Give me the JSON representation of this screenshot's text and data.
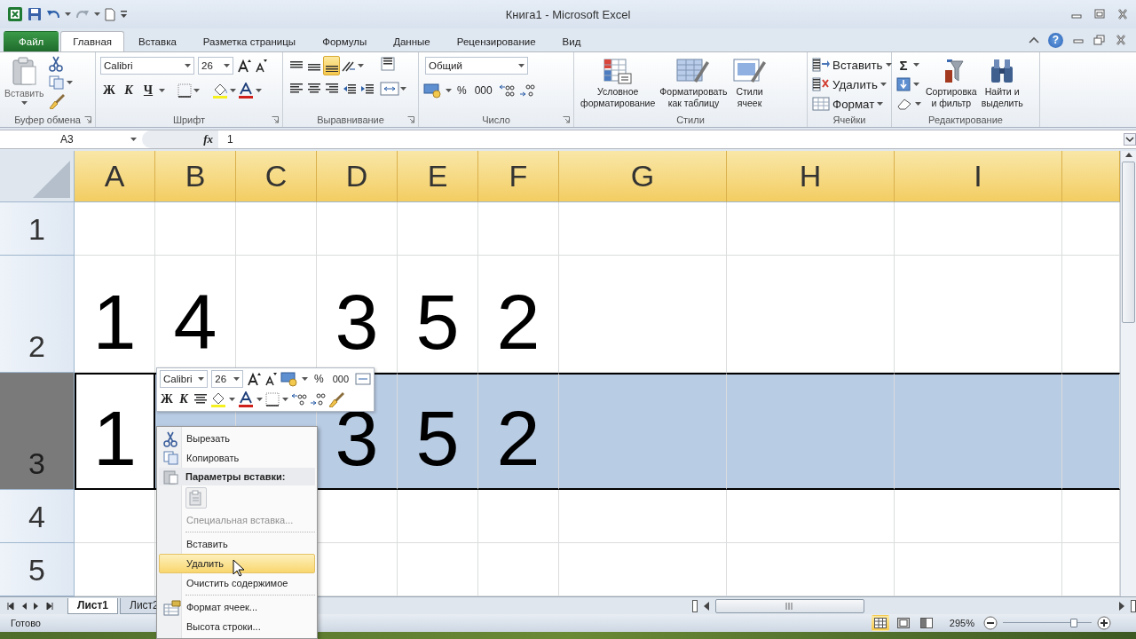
{
  "window": {
    "title": "Книга1 - Microsoft Excel",
    "help": "?"
  },
  "ribbon_tabs": [
    {
      "label": "Файл",
      "kind": "file",
      "selected": false
    },
    {
      "label": "Главная",
      "kind": "tab",
      "selected": true
    },
    {
      "label": "Вставка",
      "kind": "tab",
      "selected": false
    },
    {
      "label": "Разметка страницы",
      "kind": "tab",
      "selected": false
    },
    {
      "label": "Формулы",
      "kind": "tab",
      "selected": false
    },
    {
      "label": "Данные",
      "kind": "tab",
      "selected": false
    },
    {
      "label": "Рецензирование",
      "kind": "tab",
      "selected": false
    },
    {
      "label": "Вид",
      "kind": "tab",
      "selected": false
    }
  ],
  "ribbon_groups": [
    {
      "kind": "clipboard",
      "label": "Буфер обмена",
      "paste": "Вставить"
    },
    {
      "kind": "font",
      "label": "Шрифт",
      "font": "Calibri",
      "size": "26",
      "bold": "Ж",
      "italic": "К",
      "underline": "Ч"
    },
    {
      "kind": "alignment",
      "label": "Выравнивание",
      "align_bottom_on": true
    },
    {
      "kind": "number",
      "label": "Число",
      "format": "Общий",
      "percent": "%",
      "thousands": "000"
    },
    {
      "kind": "styles",
      "label": "Стили",
      "buttons": [
        {
          "lines": [
            "Условное",
            "форматирование"
          ]
        },
        {
          "lines": [
            "Форматировать",
            "как таблицу"
          ]
        },
        {
          "lines": [
            "Стили",
            "ячеек"
          ]
        }
      ]
    },
    {
      "kind": "cells",
      "label": "Ячейки",
      "buttons": [
        "Вставить",
        "Удалить",
        "Формат"
      ]
    },
    {
      "kind": "editing",
      "label": "Редактирование",
      "sum": "Σ",
      "buttons": [
        {
          "lines": [
            "Сортировка",
            "и фильтр"
          ]
        },
        {
          "lines": [
            "Найти и",
            "выделить"
          ]
        }
      ]
    }
  ],
  "formula_bar": {
    "name_box": "A3",
    "fx": "fx",
    "formula": "1"
  },
  "sheet": {
    "columns": [
      {
        "label": "A",
        "highlighted": true
      },
      {
        "label": "B",
        "highlighted": true
      },
      {
        "label": "C",
        "highlighted": true
      },
      {
        "label": "D",
        "highlighted": true
      },
      {
        "label": "E",
        "highlighted": true
      },
      {
        "label": "F",
        "highlighted": true
      },
      {
        "label": "G",
        "highlighted": true
      },
      {
        "label": "H",
        "highlighted": true
      },
      {
        "label": "I",
        "highlighted": true
      }
    ],
    "rows": [
      {
        "header": "1",
        "selected": false
      },
      {
        "header": "2",
        "selected": false,
        "cells": [
          {
            "value": "1",
            "active": false
          },
          {
            "value": "4",
            "active": false
          },
          null,
          {
            "value": "3",
            "active": false
          },
          {
            "value": "5",
            "active": false
          },
          {
            "value": "2",
            "active": false
          }
        ]
      },
      {
        "header": "3",
        "selected": true,
        "cells": [
          {
            "value": "1",
            "active": true
          },
          null,
          null,
          {
            "value": "3",
            "active": false
          },
          {
            "value": "5",
            "active": false
          },
          {
            "value": "2",
            "active": false
          }
        ]
      },
      {
        "header": "4",
        "selected": false
      },
      {
        "header": "5",
        "selected": false
      }
    ]
  },
  "mini_toolbar": {
    "font": "Calibri",
    "size": "26",
    "bold": "Ж",
    "italic": "К",
    "percent": "%",
    "thousands": "000"
  },
  "context_menu": [
    {
      "kind": "cut",
      "label": "Вырезать",
      "disabled": false,
      "selected": false
    },
    {
      "kind": "copy",
      "label": "Копировать",
      "disabled": false,
      "selected": false
    },
    {
      "kind": "paste-header",
      "label": "Параметры вставки:"
    },
    {
      "kind": "paste-option"
    },
    {
      "kind": "plain",
      "label": "Специальная вставка...",
      "disabled": true,
      "selected": false
    },
    {
      "kind": "separator"
    },
    {
      "kind": "plain",
      "label": "Вставить",
      "disabled": false,
      "selected": false
    },
    {
      "kind": "plain",
      "label": "Удалить",
      "disabled": false,
      "selected": true
    },
    {
      "kind": "plain",
      "label": "Очистить содержимое",
      "disabled": false,
      "selected": false
    },
    {
      "kind": "separator"
    },
    {
      "kind": "format",
      "label": "Формат ячеек...",
      "disabled": false,
      "selected": false
    },
    {
      "kind": "plain",
      "label": "Высота строки...",
      "disabled": false,
      "selected": false
    }
  ],
  "sheet_tabs": [
    {
      "label": "Лист1",
      "selected": true
    },
    {
      "label": "Лист2",
      "selected": false
    }
  ],
  "status_bar": {
    "status": "Готово",
    "views": [
      {
        "kind": "normal",
        "selected": true
      },
      {
        "kind": "page-layout",
        "selected": false
      },
      {
        "kind": "page-break",
        "selected": false
      }
    ],
    "zoom": "295%",
    "zoom_slider": {
      "level": 0.8
    }
  }
}
